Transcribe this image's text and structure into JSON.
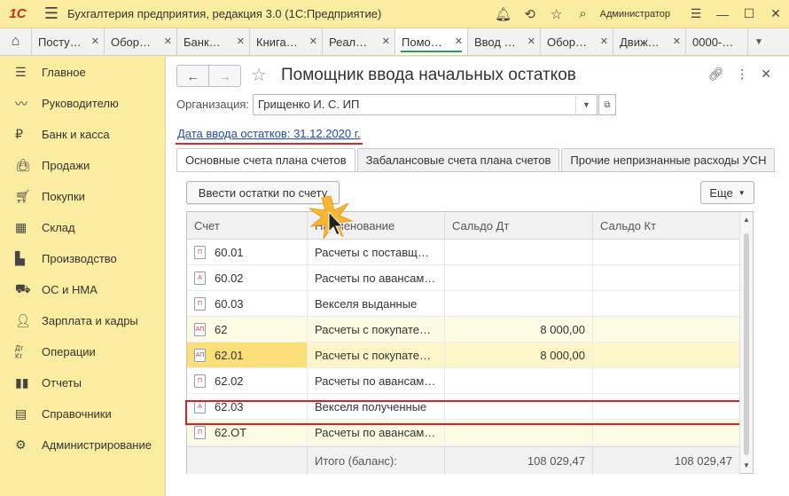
{
  "titlebar": {
    "logo": "1С",
    "app_title": "Бухгалтерия предприятия, редакция 3.0  (1С:Предприятие)",
    "user": "Администратор"
  },
  "tabs": [
    {
      "label": "Посту…"
    },
    {
      "label": "Обор…"
    },
    {
      "label": "Банк…"
    },
    {
      "label": "Книга…"
    },
    {
      "label": "Реал…"
    },
    {
      "label": "Помо…",
      "active": true
    },
    {
      "label": "Ввод …"
    },
    {
      "label": "Обор…"
    },
    {
      "label": "Движ…"
    },
    {
      "label": "0000-…"
    }
  ],
  "sidebar": {
    "items": [
      {
        "label": "Главное",
        "icon": "menu-icon"
      },
      {
        "label": "Руководителю",
        "icon": "trend-icon"
      },
      {
        "label": "Банк и касса",
        "icon": "ruble-icon"
      },
      {
        "label": "Продажи",
        "icon": "bag-icon"
      },
      {
        "label": "Покупки",
        "icon": "cart-icon"
      },
      {
        "label": "Склад",
        "icon": "warehouse-icon"
      },
      {
        "label": "Производство",
        "icon": "factory-icon"
      },
      {
        "label": "ОС и НМА",
        "icon": "truck-icon"
      },
      {
        "label": "Зарплата и кадры",
        "icon": "person-icon"
      },
      {
        "label": "Операции",
        "icon": "dt-kt-icon"
      },
      {
        "label": "Отчеты",
        "icon": "bar-chart-icon"
      },
      {
        "label": "Справочники",
        "icon": "books-icon"
      },
      {
        "label": "Администрирование",
        "icon": "gear-icon"
      }
    ]
  },
  "form": {
    "title": "Помощник ввода начальных остатков",
    "org_label": "Организация:",
    "org_value": "Грищенко И. С. ИП",
    "date_link": "Дата ввода остатков: 31.12.2020 г.",
    "tabs": [
      {
        "label": "Основные счета плана счетов",
        "active": true
      },
      {
        "label": "Забалансовые счета плана счетов"
      },
      {
        "label": "Прочие непризнанные расходы УСН"
      }
    ],
    "enter_button": "Ввести остатки по счету",
    "more_button": "Еще"
  },
  "table": {
    "columns": [
      "Счет",
      "Наименование",
      "Сальдо Дт",
      "Сальдо Кт"
    ],
    "rows": [
      {
        "account": "60.01",
        "icon": "П",
        "name": "Расчеты с поставщ…",
        "dt": "",
        "kt": "",
        "yellow": false
      },
      {
        "account": "60.02",
        "icon": "А",
        "name": "Расчеты по авансам…",
        "dt": "",
        "kt": "",
        "yellow": false
      },
      {
        "account": "60.03",
        "icon": "П",
        "name": "Векселя выданные",
        "dt": "",
        "kt": "",
        "yellow": false
      },
      {
        "account": "62",
        "icon": "АП",
        "name": "Расчеты с покупате…",
        "dt": "8 000,00",
        "kt": "",
        "yellow": true
      },
      {
        "account": "62.01",
        "icon": "АП",
        "name": "Расчеты с покупате…",
        "dt": "8 000,00",
        "kt": "",
        "yellow": true,
        "selected": true
      },
      {
        "account": "62.02",
        "icon": "П",
        "name": "Расчеты по авансам…",
        "dt": "",
        "kt": "",
        "yellow": false
      },
      {
        "account": "62.03",
        "icon": "А",
        "name": "Векселя полученные",
        "dt": "",
        "kt": "",
        "yellow": false
      },
      {
        "account": "62.ОТ",
        "icon": "П",
        "name": "Расчеты по авансам…",
        "dt": "",
        "kt": "",
        "yellow": true
      }
    ],
    "footer": {
      "label": "Итого (баланс):",
      "dt": "108 029,47",
      "kt": "108 029,47"
    }
  },
  "colors": {
    "sidebar_bg": "#fbeda0",
    "highlight_red": "#d82127",
    "link_blue": "#1f4ea3",
    "active_tab_green": "#2c9d5b"
  }
}
